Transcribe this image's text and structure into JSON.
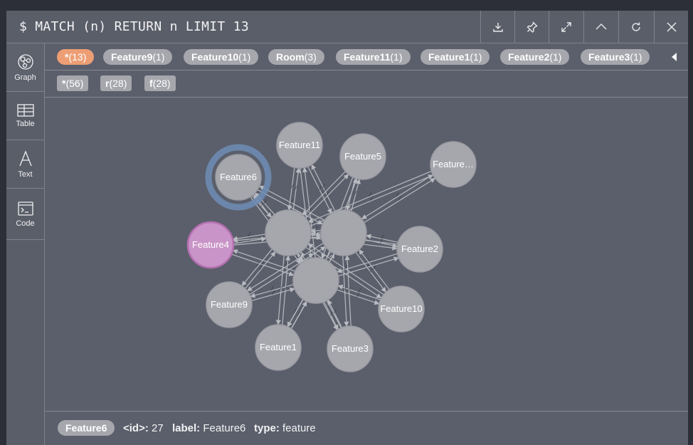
{
  "query": "$ MATCH (n) RETURN n LIMIT 13",
  "toolbar": {
    "buttons": [
      "download-icon",
      "pin-icon",
      "expand-icon",
      "collapse-up-icon",
      "refresh-icon",
      "close-icon"
    ]
  },
  "sidebar": {
    "items": [
      {
        "label": "Graph",
        "icon": "graph-icon"
      },
      {
        "label": "Table",
        "icon": "table-icon"
      },
      {
        "label": "Text",
        "icon": "text-icon"
      },
      {
        "label": "Code",
        "icon": "code-icon"
      }
    ]
  },
  "node_labels": [
    {
      "name": "*",
      "count": "(13)"
    },
    {
      "name": "Feature9",
      "count": "(1)"
    },
    {
      "name": "Feature10",
      "count": "(1)"
    },
    {
      "name": "Room",
      "count": "(3)"
    },
    {
      "name": "Feature11",
      "count": "(1)"
    },
    {
      "name": "Feature1",
      "count": "(1)"
    },
    {
      "name": "Feature2",
      "count": "(1)"
    },
    {
      "name": "Feature3",
      "count": "(1)"
    }
  ],
  "rel_types": [
    {
      "name": "*",
      "count": "(56)"
    },
    {
      "name": "r",
      "count": "(28)"
    },
    {
      "name": "f",
      "count": "(28)"
    }
  ],
  "colors": {
    "node_default": "#a6a7ad",
    "node_selected_ring": "#6f8db5",
    "node_highlight": "#c994c7",
    "node_highlight_stroke": "#b46fb0",
    "all_chip": "#ed9e74",
    "edge": "#b8bac0"
  },
  "graph": {
    "nodes": [
      {
        "id": "room1",
        "label": ""
      },
      {
        "id": "room2",
        "label": ""
      },
      {
        "id": "room3",
        "label": ""
      },
      {
        "id": "f6",
        "label": "Feature6",
        "selected": true
      },
      {
        "id": "f11",
        "label": "Feature11"
      },
      {
        "id": "f5",
        "label": "Feature5"
      },
      {
        "id": "fx",
        "label": "Feature…"
      },
      {
        "id": "f4",
        "label": "Feature4",
        "highlight": true
      },
      {
        "id": "f2",
        "label": "Feature2"
      },
      {
        "id": "f9",
        "label": "Feature9"
      },
      {
        "id": "f10",
        "label": "Feature10"
      },
      {
        "id": "f1",
        "label": "Feature1"
      },
      {
        "id": "f3",
        "label": "Feature3"
      }
    ]
  },
  "details": {
    "node_label": "Feature6",
    "id_key": "<id>:",
    "id_value": "27",
    "label_key": "label:",
    "label_value": "Feature6",
    "type_key": "type:",
    "type_value": "feature"
  }
}
